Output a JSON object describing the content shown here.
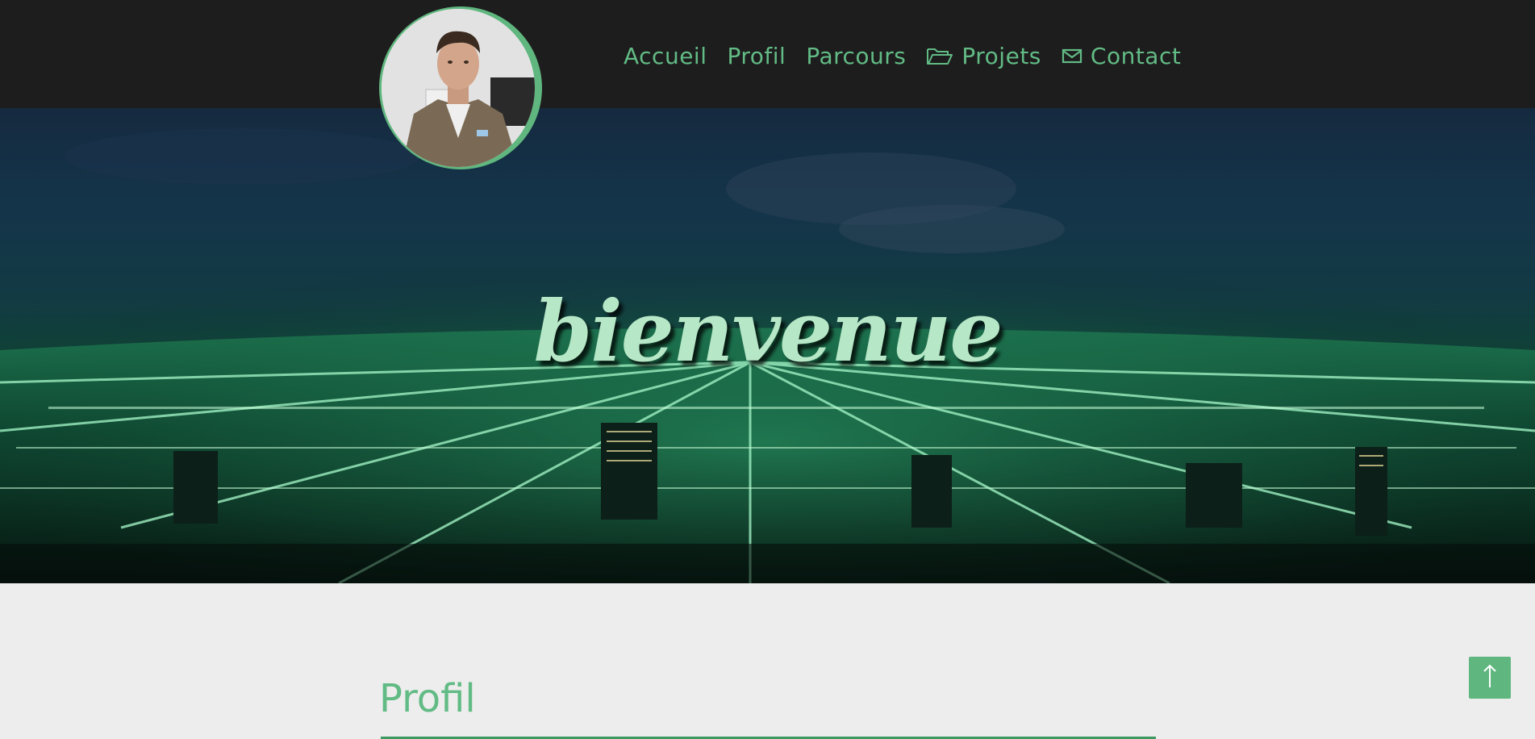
{
  "nav": {
    "items": [
      {
        "label": "Accueil",
        "icon": ""
      },
      {
        "label": "Profil",
        "icon": ""
      },
      {
        "label": "Parcours",
        "icon": ""
      },
      {
        "label": "Projets",
        "icon": "folder-open-icon"
      },
      {
        "label": "Contact",
        "icon": "envelope-icon"
      }
    ]
  },
  "hero": {
    "title": "bienvenue"
  },
  "section": {
    "title": "Profil"
  },
  "colors": {
    "accent": "#62bb85",
    "topbar": "#1d1d1d",
    "page_bg": "#ededed",
    "hero_title": "#b6e7c6"
  },
  "scroll_top": {
    "icon": "arrow-up-icon"
  }
}
